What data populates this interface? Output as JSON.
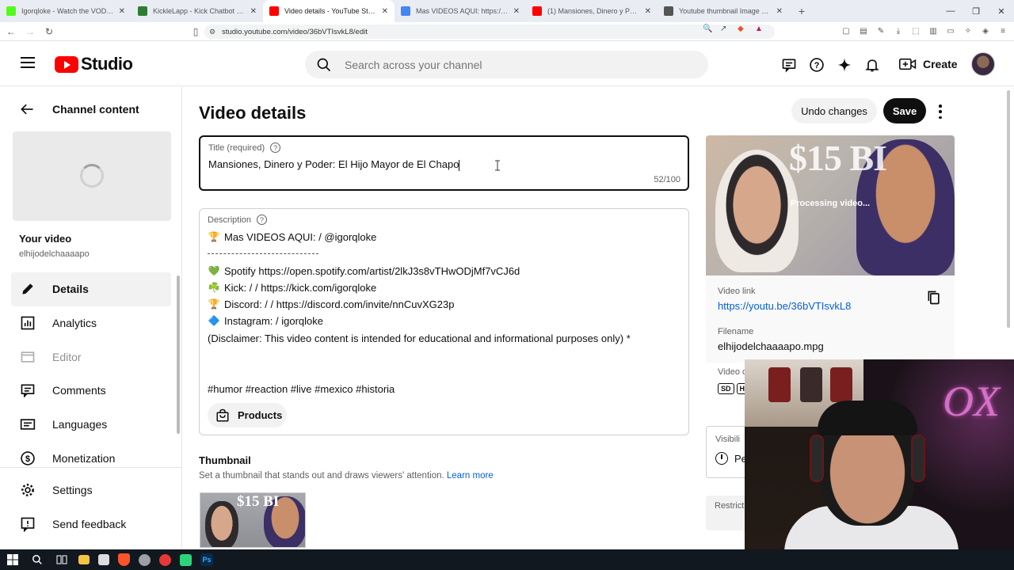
{
  "browser": {
    "tabs": [
      {
        "label": "Igorqloke - Watch the VOD on Kick",
        "color": "#53fc18"
      },
      {
        "label": "KickleLapp - Kick Chatbot and Overlays",
        "color": "#2e7d32"
      },
      {
        "label": "Video details - YouTube Studio",
        "color": "#ff0000",
        "active": true
      },
      {
        "label": "Mas VIDEOS AQUI: https://www...",
        "color": "#4285f4"
      },
      {
        "label": "(1) Mansiones, Dinero y Poder: El Hijo...",
        "color": "#ff0000"
      },
      {
        "label": "Youtube thumbnail Image View and ...",
        "color": "#555555"
      }
    ],
    "new_tab": "+",
    "url": "studio.youtube.com/video/36bVTIsvkL8/edit"
  },
  "header": {
    "logo_text": "Studio",
    "search_placeholder": "Search across your channel",
    "create_label": "Create"
  },
  "sidebar": {
    "back_label": "Channel content",
    "your_video": "Your video",
    "channel_name": "elhijodelchaaaapo",
    "items": [
      {
        "label": "Details",
        "icon": "pencil-icon",
        "active": true
      },
      {
        "label": "Analytics",
        "icon": "analytics-icon"
      },
      {
        "label": "Editor",
        "icon": "editor-icon",
        "disabled": true
      },
      {
        "label": "Comments",
        "icon": "comments-icon"
      },
      {
        "label": "Languages",
        "icon": "languages-icon"
      },
      {
        "label": "Monetization",
        "icon": "monetization-icon"
      }
    ],
    "bottom_items": [
      {
        "label": "Settings",
        "icon": "gear-icon"
      },
      {
        "label": "Send feedback",
        "icon": "feedback-icon"
      }
    ]
  },
  "main": {
    "page_title": "Video details",
    "undo_label": "Undo changes",
    "save_label": "Save",
    "title_field": {
      "label": "Title (required)",
      "value": "Mansiones, Dinero y Poder: El Hijo Mayor de El Chapo",
      "counter": "52/100"
    },
    "description": {
      "label": "Description",
      "lines": [
        {
          "emoji": "🏆",
          "text": "Mas VIDEOS AQUI:    / @igorqloke"
        },
        {
          "emoji": "",
          "text": "",
          "dashes": true
        },
        {
          "emoji": "💚",
          "text": "Spotify  https://open.spotify.com/artist/2lkJ3s8vTHwODjMf7vCJ6d"
        },
        {
          "emoji": "☘️",
          "text": "Kick:   /   / https://kick.com/igorqloke"
        },
        {
          "emoji": "🏆",
          "text": "Discord:   /   /    https://discord.com/invite/nnCuvXG23p"
        },
        {
          "emoji": "🔷",
          "text": "Instagram:   / igorqloke"
        },
        {
          "emoji": "",
          "text": "(Disclaimer: This video content is intended for educational and informational purposes only) *"
        },
        {
          "emoji": "",
          "text": ""
        },
        {
          "emoji": "",
          "text": ""
        },
        {
          "emoji": "",
          "text": "#humor #reaction #live #mexico #historia"
        }
      ],
      "products_label": "Products"
    },
    "thumbnail": {
      "title": "Thumbnail",
      "subtitle": "Set a thumbnail that stands out and draws viewers' attention.",
      "learn_more": "Learn more"
    }
  },
  "right_panel": {
    "preview_overlay_text": "$15 BI",
    "processing": "Processing video...",
    "video_link_label": "Video link",
    "video_link": "https://youtu.be/36bVTIsvkL8",
    "filename_label": "Filename",
    "filename": "elhijodelchaaaapo.mpg",
    "quality_label": "Video q",
    "quality_badges": [
      "SD",
      "H"
    ],
    "visibility_label": "Visibili",
    "visibility_value": "Pe",
    "restrictions_label": "Restrict"
  },
  "webcam": {
    "overlay_text": "OX"
  }
}
